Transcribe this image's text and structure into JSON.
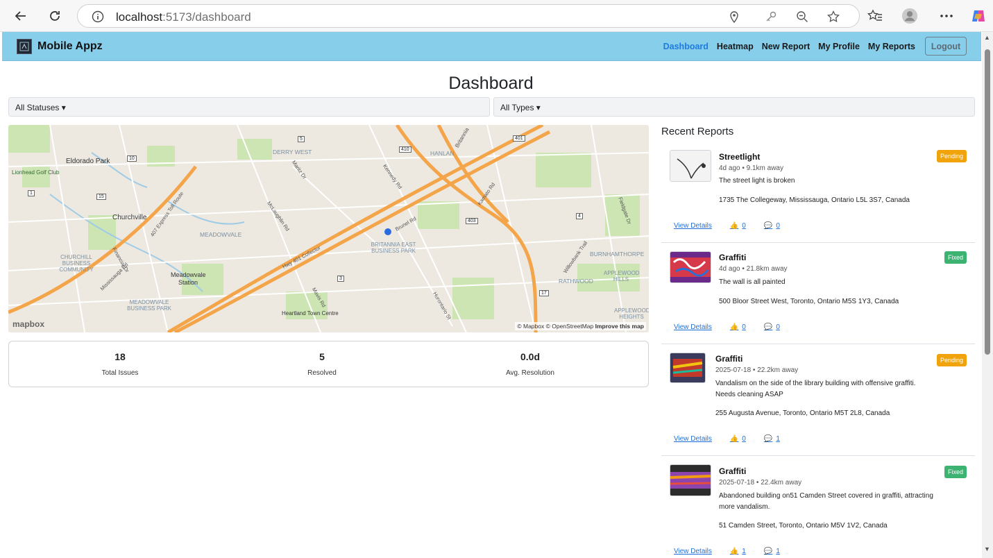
{
  "browser": {
    "url_host": "localhost",
    "url_path": ":5173/dashboard"
  },
  "header": {
    "brand": "Mobile Appz",
    "nav": [
      "Dashboard",
      "Heatmap",
      "New Report",
      "My Profile",
      "My Reports"
    ],
    "logout": "Logout"
  },
  "page": {
    "title": "Dashboard",
    "status_filter": "All Statuses",
    "type_filter": "All Types"
  },
  "map": {
    "attribution": "© Mapbox © OpenStreetMap",
    "improve": "Improve this map",
    "logo": "mapbox",
    "labels": [
      "Eldorado Park",
      "Lionhead Golf Club",
      "Churchville",
      "CHURCHILL BUSINESS COMMUNITY",
      "MEADOWVALE",
      "Meadowvale Station",
      "MEADOWVALE BUSINESS PARK",
      "DERRY WEST",
      "HANLAN",
      "BRITANNIA EAST BUSINESS PARK",
      "BURNHAMTHORPE",
      "APPLEWOOD HILLS",
      "RATHWOOD",
      "APPLEWOOD HEIGHTS",
      "Heartland Town Centre",
      "Brunel Rd",
      "Kennedy Rd",
      "Hurontario St",
      "Mavis Rd",
      "McLaughlin Rd",
      "Financial Dr",
      "Hwy 401 Collector",
      "407 Express Toll Route",
      "Mississauga Rd",
      "Kamato Rd",
      "Fieldgate Dr",
      "Willowbank Trail",
      "Britannia",
      "Maritz Dr"
    ],
    "shields": [
      "401",
      "410",
      "403",
      "5",
      "10",
      "15",
      "1",
      "4",
      "17",
      "3"
    ]
  },
  "stats": [
    {
      "value": "18",
      "label": "Total Issues"
    },
    {
      "value": "5",
      "label": "Resolved"
    },
    {
      "value": "0.0d",
      "label": "Avg. Resolution"
    }
  ],
  "recent": {
    "title": "Recent Reports",
    "reports": [
      {
        "title": "Streetlight",
        "meta": "4d ago • 9.1km away",
        "desc": "The street light is broken",
        "address": "1735 The Collegeway, Mississauga, Ontario L5L 3S7, Canada",
        "status": "Pending",
        "view": "View Details",
        "likes": "0",
        "comments": "0"
      },
      {
        "title": "Graffiti",
        "meta": "4d ago • 21.8km away",
        "desc": "The wall is all painted",
        "address": "500 Bloor Street West, Toronto, Ontario M5S 1Y3, Canada",
        "status": "Fixed",
        "view": "View Details",
        "likes": "0",
        "comments": "0"
      },
      {
        "title": "Graffiti",
        "meta": "2025-07-18 • 22.2km away",
        "desc": "Vandalism on the side of the library building with offensive graffiti. Needs cleaning ASAP",
        "address": "255 Augusta Avenue, Toronto, Ontario M5T 2L8, Canada",
        "status": "Pending",
        "view": "View Details",
        "likes": "0",
        "comments": "1"
      },
      {
        "title": "Graffiti",
        "meta": "2025-07-18 • 22.4km away",
        "desc": "Abandoned building on51 Camden Street covered in graffiti, attracting more vandalism.",
        "address": "51 Camden Street, Toronto, Ontario M5V 1V2, Canada",
        "status": "Fixed",
        "view": "View Details",
        "likes": "1",
        "comments": "1"
      }
    ]
  }
}
